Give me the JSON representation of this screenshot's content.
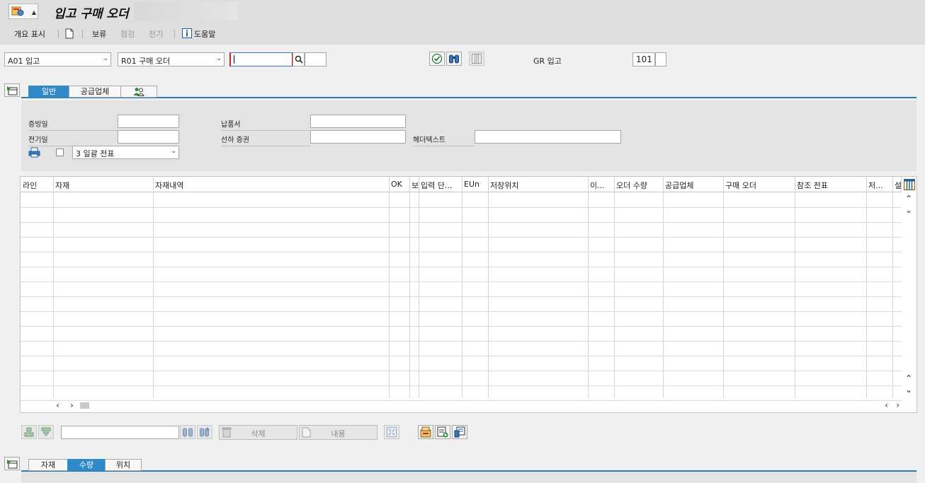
{
  "window": {
    "title": "입고 구매 오더"
  },
  "toolbar": {
    "overview": "개요 표시",
    "hold": "보류",
    "check": "점검",
    "post": "전기",
    "help": "도움말"
  },
  "header": {
    "transaction": "A01 입고",
    "reference": "R01 구매 오더",
    "search_value": "",
    "gr_label": "GR 입고",
    "movement_type": "101"
  },
  "top_tabs": [
    "일반",
    "공급업체",
    ""
  ],
  "general": {
    "doc_date_label": "증빙일",
    "posting_date_label": "전기일",
    "delivery_note_label": "납품서",
    "bill_of_lading_label": "선하 증권",
    "header_text_label": "헤더텍스트",
    "print_option": "3 일괄 전표"
  },
  "table": {
    "columns": [
      "라인",
      "자재",
      "자재내역",
      "OK",
      "보",
      "입력 단...",
      "EUn",
      "저장위치",
      "이...",
      "오더 수량",
      "공급업체",
      "구매 오더",
      "참조 전표",
      "저...",
      "설"
    ],
    "rows": []
  },
  "bottom_toolbar": {
    "delete": "삭제",
    "content": "내용"
  },
  "bottom_tabs": [
    "자재",
    "수량",
    "위치"
  ]
}
